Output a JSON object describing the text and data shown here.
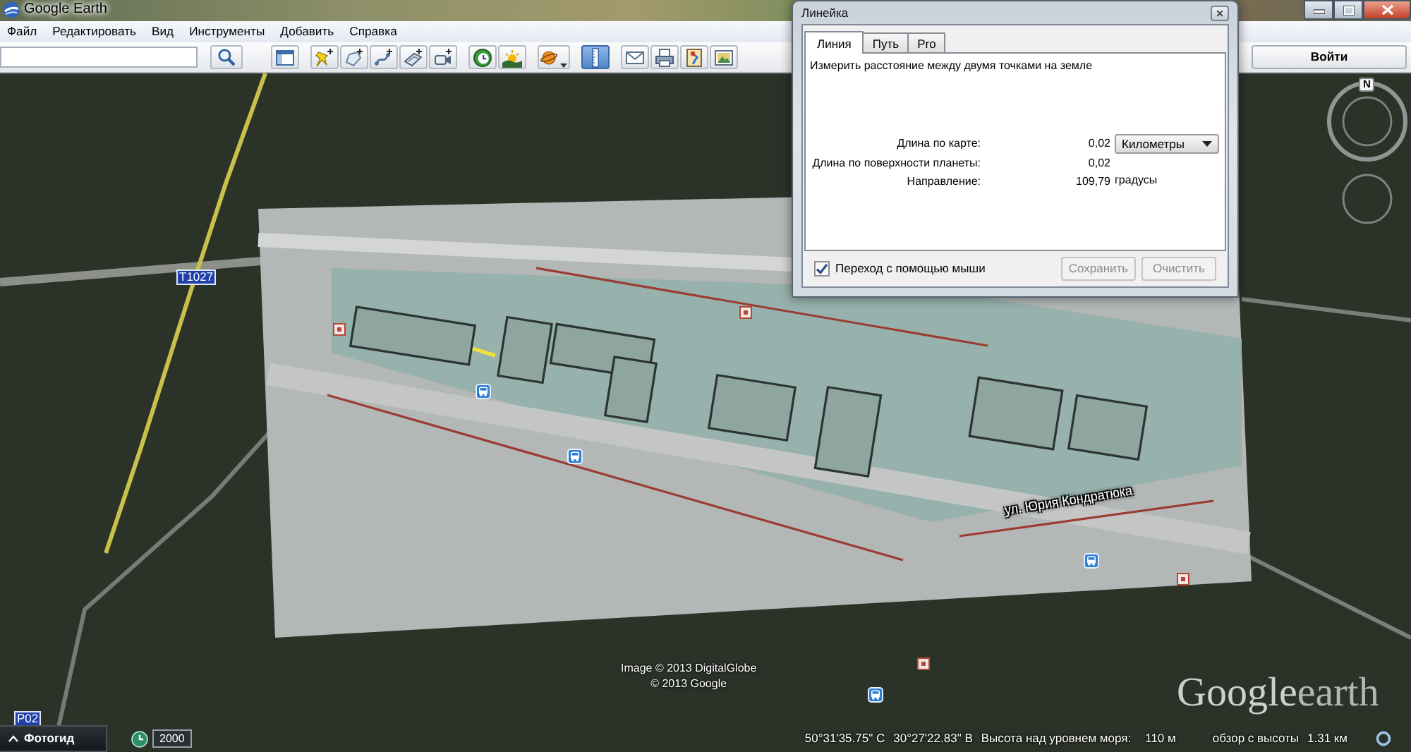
{
  "window": {
    "title": "Google Earth"
  },
  "menu": [
    "Файл",
    "Редактировать",
    "Вид",
    "Инструменты",
    "Добавить",
    "Справка"
  ],
  "toolbar": {
    "groups": [
      [
        {
          "selected": false
        }
      ],
      [
        {
          "selected": false
        },
        {
          "selected": false
        },
        {
          "selected": false
        },
        {
          "selected": false
        },
        {
          "selected": false
        }
      ],
      [
        {
          "selected": false
        },
        {
          "selected": false
        }
      ],
      [
        {
          "selected": false
        }
      ],
      [
        {
          "selected": true
        }
      ],
      [
        {
          "selected": false
        },
        {
          "selected": false
        },
        {
          "selected": false
        },
        {
          "selected": false
        }
      ]
    ],
    "sign_in": "Войти"
  },
  "ruler_dialog": {
    "title": "Линейка",
    "tabs": [
      {
        "label": "Линия",
        "selected": true
      },
      {
        "label": "Путь",
        "selected": false
      },
      {
        "label": "Pro",
        "selected": false
      }
    ],
    "description": "Измерить расстояние между двумя точками на земле",
    "rows": [
      {
        "label": "Длина по карте:",
        "value": "0,02",
        "kind": "select",
        "unit": "Километры"
      },
      {
        "label": "Длина по поверхности планеты:",
        "value": "0,02",
        "kind": "plain"
      },
      {
        "label": "Направление:",
        "value": "109,79",
        "kind": "text",
        "unit": "градусы"
      }
    ],
    "mouse_navigation": {
      "label": "Переход с помощью мыши",
      "checked": true
    },
    "buttons": [
      {
        "label": "Сохранить",
        "disabled": true
      },
      {
        "label": "Очистить",
        "disabled": true
      }
    ]
  },
  "map": {
    "route_labels": [
      "Т1027",
      "Р02"
    ],
    "street_label": "ул. Юрия Кондратюка",
    "attribution": [
      "Image © 2013 DigitalGlobe",
      "© 2013 Google"
    ],
    "logo": [
      "Google",
      "earth"
    ],
    "compass_label": "N"
  },
  "status_bar": {
    "photo_guide": "Фотогид",
    "imagery_date": "2000",
    "latitude": "50°31'35.75\" С",
    "longitude": "30°27'22.83\" В",
    "elevation_label": "Высота над уровнем моря:",
    "elevation": "110 м",
    "eye_altitude_label": "обзор с высоты",
    "eye_altitude": "1.31 км"
  }
}
